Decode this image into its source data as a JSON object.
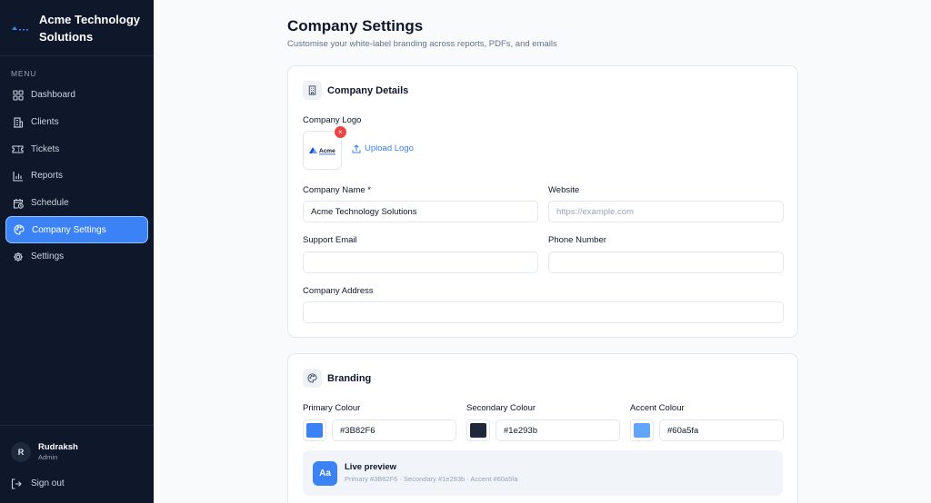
{
  "brand": {
    "name_line1": "Acme Technology",
    "name_line2": "Solutions"
  },
  "sidebar": {
    "menu_heading": "MENU",
    "items": [
      {
        "label": "Dashboard",
        "icon": "dashboard-icon"
      },
      {
        "label": "Clients",
        "icon": "building-icon"
      },
      {
        "label": "Tickets",
        "icon": "ticket-icon"
      },
      {
        "label": "Reports",
        "icon": "bar-chart-icon"
      },
      {
        "label": "Schedule",
        "icon": "calendar-clock-icon"
      },
      {
        "label": "Company Settings",
        "icon": "palette-icon",
        "active": true
      },
      {
        "label": "Settings",
        "icon": "gear-icon"
      }
    ]
  },
  "user": {
    "initial": "R",
    "name": "Rudraksh",
    "role": "Admin",
    "signout_label": "Sign out"
  },
  "page": {
    "title": "Company Settings",
    "subtitle": "Customise your white-label branding across reports, PDFs, and emails"
  },
  "company_details": {
    "title": "Company Details",
    "logo_label": "Company Logo",
    "logo_text": "Acme",
    "remove_symbol": "×",
    "upload_label": "Upload Logo",
    "company_name_label": "Company Name *",
    "company_name_value": "Acme Technology Solutions",
    "website_label": "Website",
    "website_placeholder": "https://example.com",
    "support_email_label": "Support Email",
    "support_email_value": "",
    "phone_label": "Phone Number",
    "phone_value": "",
    "address_label": "Company Address",
    "address_value": ""
  },
  "branding": {
    "title": "Branding",
    "primary_label": "Primary Colour",
    "primary_value": "#3B82F6",
    "secondary_label": "Secondary Colour",
    "secondary_value": "#1e293b",
    "accent_label": "Accent Colour",
    "accent_value": "#60a5fa",
    "preview_badge": "Aa",
    "preview_title": "Live preview",
    "preview_meta": "Primary #3B82F6 · Secondary #1e293b · Accent #60a5fa"
  },
  "colors": {
    "sidebar_bg": "#0f172a",
    "active_bg": "#3b82f6",
    "primary": "#3B82F6",
    "secondary": "#1e293b",
    "accent": "#60a5fa",
    "danger": "#ef4444"
  }
}
